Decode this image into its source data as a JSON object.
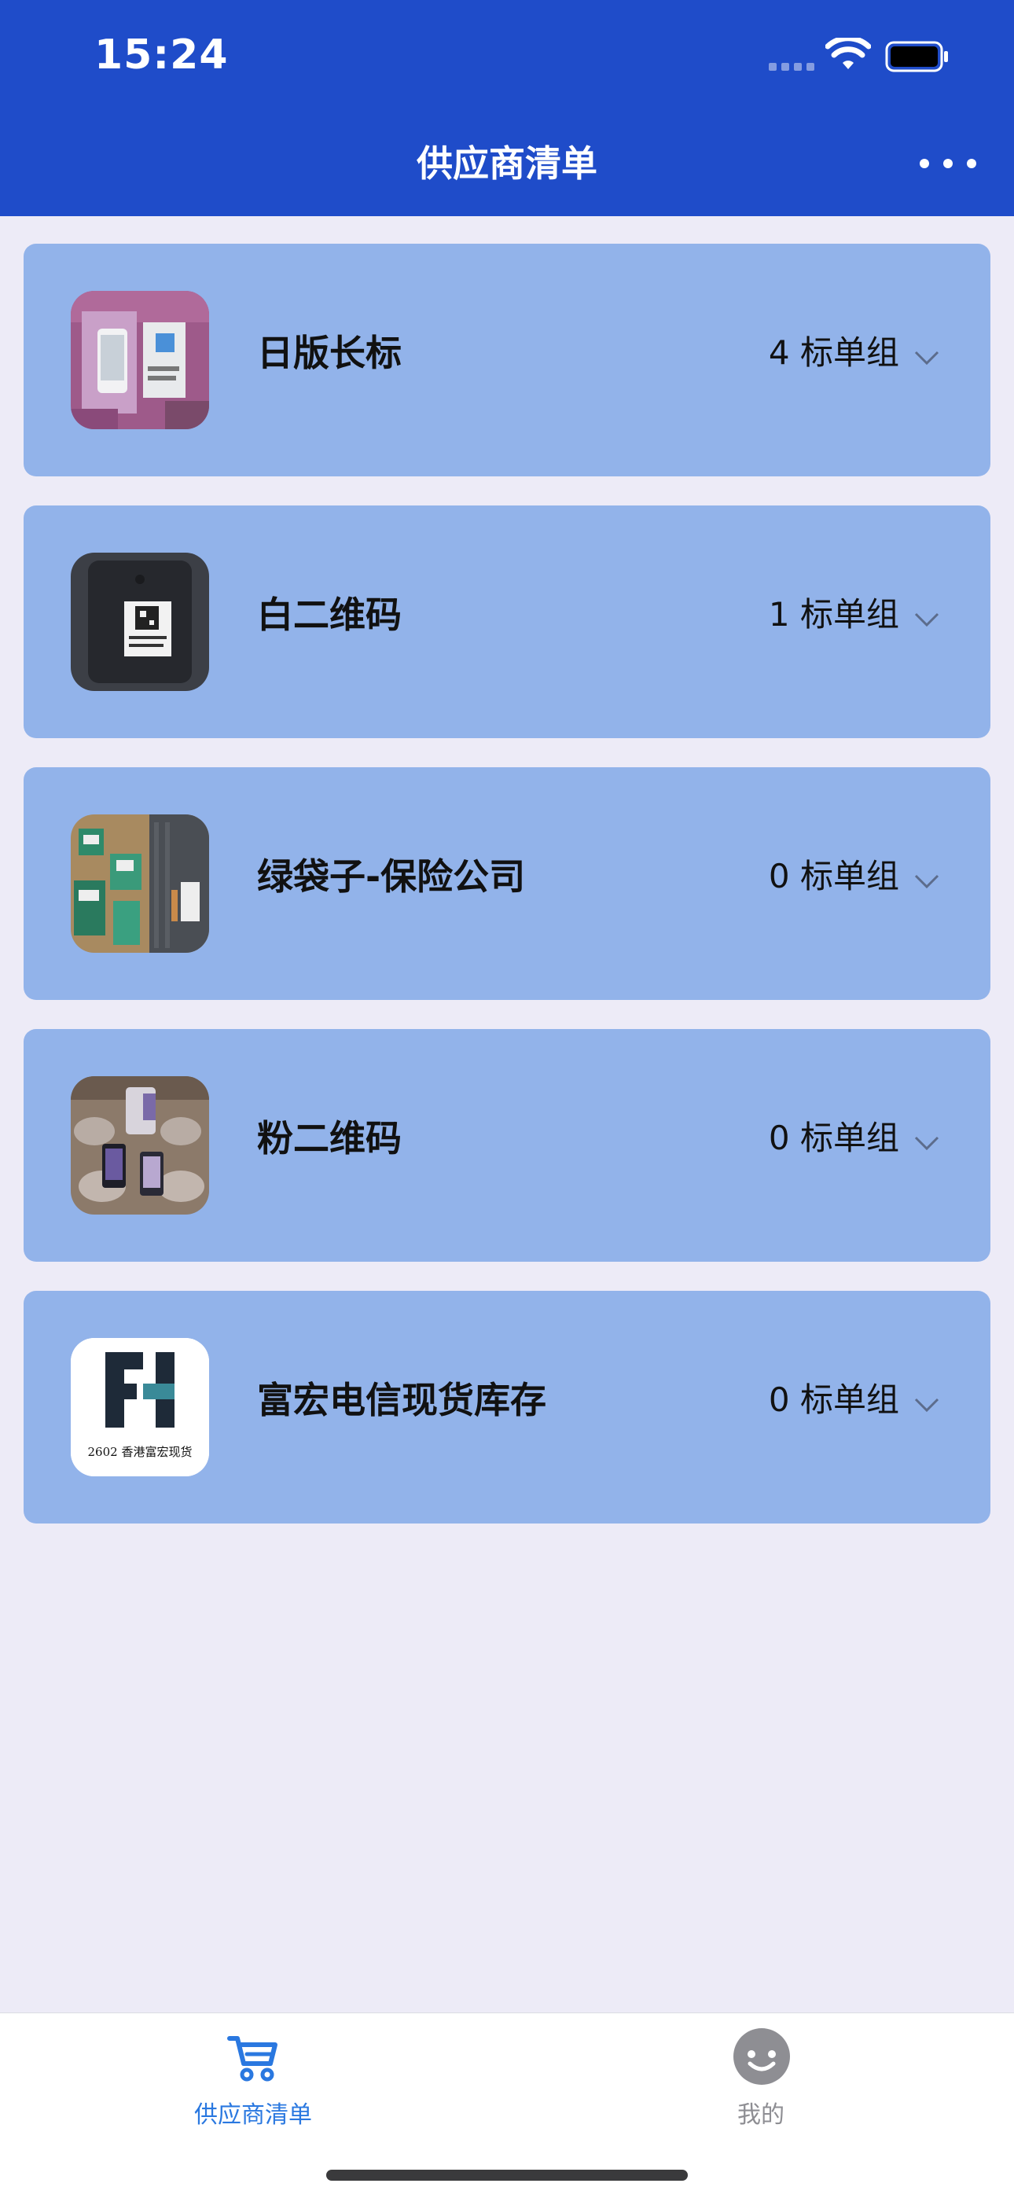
{
  "status_bar": {
    "time": "15:24"
  },
  "header": {
    "title": "供应商清单",
    "more_icon": "more-icon",
    "background_color": "#1F4CC9"
  },
  "suppliers": [
    {
      "name": "日版长标",
      "group_count": "4 标单组",
      "thumbnail_icon": "photo-phones-pink-bags"
    },
    {
      "name": "白二维码",
      "group_count": "1 标单组",
      "thumbnail_icon": "photo-qr-label"
    },
    {
      "name": "绿袋子-保险公司",
      "group_count": "0 标单组",
      "thumbnail_icon": "photo-green-bags"
    },
    {
      "name": "粉二维码",
      "group_count": "0 标单组",
      "thumbnail_icon": "photo-phones-wrapped"
    },
    {
      "name": "富宏电信现货库存",
      "group_count": "0 标单组",
      "thumbnail_icon": "logo-fh",
      "logo_caption": "2602 香港富宏现货"
    }
  ],
  "tab_bar": {
    "tabs": [
      {
        "label": "供应商清单",
        "icon": "cart-icon",
        "active": true
      },
      {
        "label": "我的",
        "icon": "smiley-icon",
        "active": false
      }
    ],
    "active_color": "#2A78E0",
    "inactive_color": "#8E8E93"
  },
  "colors": {
    "card_background": "#92B3EA",
    "page_background": "#EDEBF7"
  }
}
